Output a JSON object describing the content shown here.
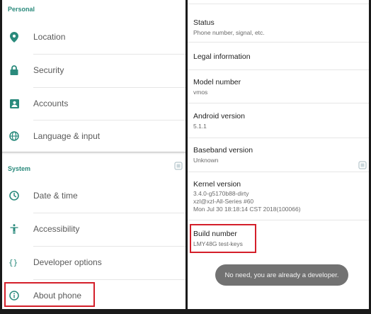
{
  "left_panel": {
    "personal_header": "Personal",
    "personal_items": [
      {
        "label": "Location",
        "icon": "location-pin-icon"
      },
      {
        "label": "Security",
        "icon": "lock-icon"
      },
      {
        "label": "Accounts",
        "icon": "account-icon"
      },
      {
        "label": "Language & input",
        "icon": "globe-icon"
      }
    ],
    "system_header": "System",
    "system_items": [
      {
        "label": "Date & time",
        "icon": "clock-icon"
      },
      {
        "label": "Accessibility",
        "icon": "accessibility-icon"
      },
      {
        "label": "Developer options",
        "icon": "braces-icon"
      },
      {
        "label": "About phone",
        "icon": "info-icon"
      }
    ],
    "icon_color": "#2a8a7c"
  },
  "right_panel": {
    "items": [
      {
        "title": "Status",
        "subtitle": "Phone number, signal, etc."
      },
      {
        "title": "Legal information"
      },
      {
        "title": "Model number",
        "subtitle": "vmos"
      },
      {
        "title": "Android version",
        "subtitle": "5.1.1"
      },
      {
        "title": "Baseband version",
        "subtitle": "Unknown"
      },
      {
        "title": "Kernel version",
        "subtitle_lines": [
          "3.4.0-g5170b88-dirty",
          "xzl@xzl-All-Series #60",
          "Mon Jul 30 18:18:14 CST 2018(100066)"
        ]
      },
      {
        "title": "Build number",
        "subtitle": "LMY48G test-keys"
      }
    ]
  },
  "toast": {
    "text": "No need, you are already a developer."
  },
  "highlight_color": "#d41f2a"
}
